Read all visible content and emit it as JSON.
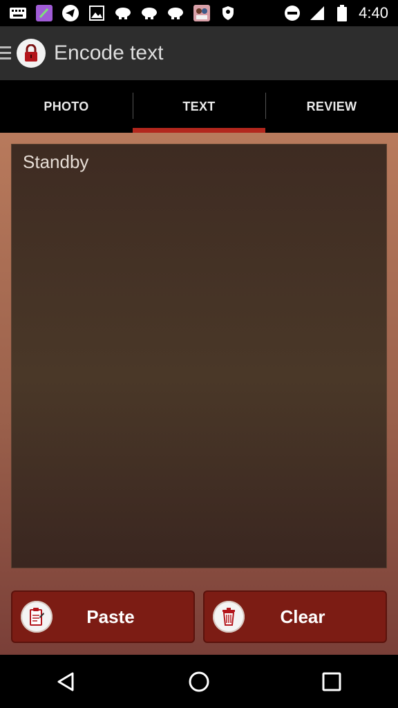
{
  "status_bar": {
    "time": "4:40",
    "icons": [
      "keyboard-icon",
      "app-icon",
      "telegram-icon",
      "image-icon",
      "teamviewer-icon",
      "teamviewer-icon",
      "teamviewer-icon",
      "photo-app-icon",
      "shield-icon"
    ],
    "right_icons": [
      "do-not-disturb-icon",
      "signal-icon",
      "battery-icon"
    ]
  },
  "app_bar": {
    "title": "Encode text"
  },
  "tabs": [
    {
      "label": "PHOTO",
      "active": false
    },
    {
      "label": "TEXT",
      "active": true
    },
    {
      "label": "REVIEW",
      "active": false
    }
  ],
  "editor": {
    "value": "Standby"
  },
  "buttons": {
    "paste_label": "Paste",
    "clear_label": "Clear"
  },
  "colors": {
    "accent": "#b3271d",
    "button_bg": "#7c1c14",
    "app_bar_bg": "#2d2d2d"
  }
}
